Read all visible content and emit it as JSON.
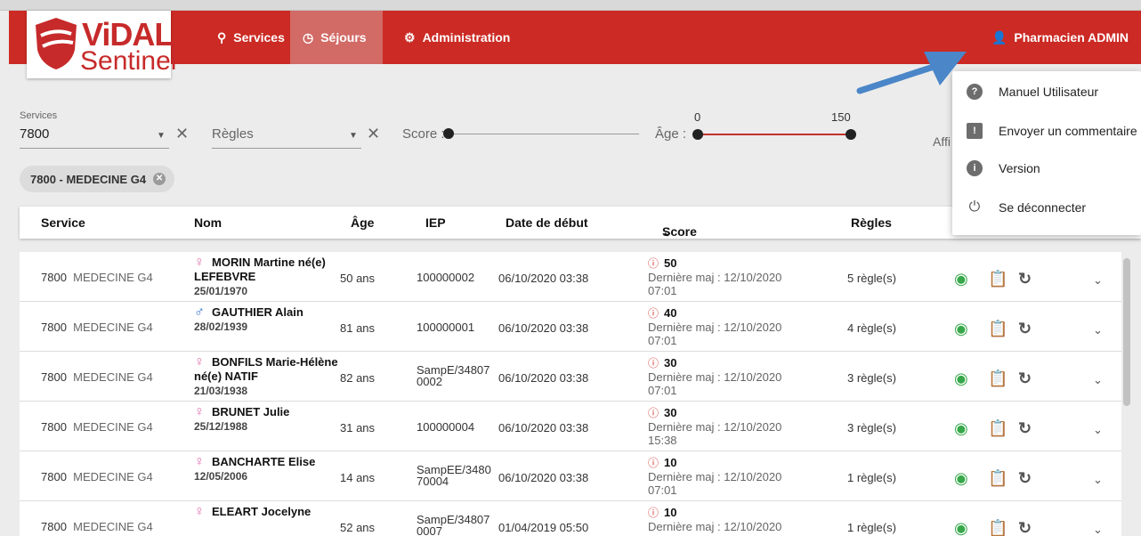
{
  "header": {
    "logo_line1": "ViDAL",
    "logo_line2": "Sentinel",
    "nav": {
      "services": "Services",
      "sejours": "Séjours",
      "administration": "Administration",
      "user": "Pharmacien ADMIN"
    }
  },
  "filters": {
    "services_label": "Services",
    "services_value": "7800",
    "regles_placeholder": "Règles",
    "score_label": "Score :",
    "age_label": "Âge :",
    "age_min": "0",
    "age_max": "150",
    "affiche_label": "Affi",
    "chip": "7800 - MEDECINE G4"
  },
  "table": {
    "headers": {
      "service": "Service",
      "nom": "Nom",
      "age": "Âge",
      "iep": "IEP",
      "date": "Date de début",
      "score": "Score",
      "regles": "Règles"
    },
    "rows": [
      {
        "svc_code": "7800",
        "svc_name": "MEDECINE G4",
        "sex": "♀",
        "sex_class": "f",
        "name": "MORIN Martine né(e) LEFEBVRE",
        "dob": "25/01/1970",
        "age": "50 ans",
        "iep": "100000002",
        "date": "06/10/2020 03:38",
        "score": "50",
        "maj": "Dernière maj : 12/10/2020",
        "maj_time": "07:01",
        "rules": "5 règle(s)"
      },
      {
        "svc_code": "7800",
        "svc_name": "MEDECINE G4",
        "sex": "♂",
        "sex_class": "m",
        "name": "GAUTHIER Alain",
        "dob": "28/02/1939",
        "age": "81 ans",
        "iep": "100000001",
        "date": "06/10/2020 03:38",
        "score": "40",
        "maj": "Dernière maj : 12/10/2020",
        "maj_time": "07:01",
        "rules": "4 règle(s)"
      },
      {
        "svc_code": "7800",
        "svc_name": "MEDECINE G4",
        "sex": "♀",
        "sex_class": "f",
        "name": "BONFILS Marie-Hélène né(e) NATIF",
        "dob": "21/03/1938",
        "age": "82 ans",
        "iep": "SampE/348070002",
        "date": "06/10/2020 03:38",
        "score": "30",
        "maj": "Dernière maj : 12/10/2020",
        "maj_time": "07:01",
        "rules": "3 règle(s)"
      },
      {
        "svc_code": "7800",
        "svc_name": "MEDECINE G4",
        "sex": "♀",
        "sex_class": "f",
        "name": "BRUNET Julie",
        "dob": "25/12/1988",
        "age": "31 ans",
        "iep": "100000004",
        "date": "06/10/2020 03:38",
        "score": "30",
        "maj": "Dernière maj : 12/10/2020",
        "maj_time": "15:38",
        "rules": "3 règle(s)"
      },
      {
        "svc_code": "7800",
        "svc_name": "MEDECINE G4",
        "sex": "♀",
        "sex_class": "f",
        "name": "BANCHARTE Elise",
        "dob": "12/05/2006",
        "age": "14 ans",
        "iep": "SampEE/348070004",
        "date": "06/10/2020 03:38",
        "score": "10",
        "maj": "Dernière maj : 12/10/2020",
        "maj_time": "07:01",
        "rules": "1 règle(s)"
      },
      {
        "svc_code": "7800",
        "svc_name": "MEDECINE G4",
        "sex": "♀",
        "sex_class": "f",
        "name": "ELEART Jocelyne",
        "dob": "",
        "age": "52 ans",
        "iep": "SampE/348070007",
        "date": "01/04/2019 05:50",
        "score": "10",
        "maj": "Dernière maj : 12/10/2020",
        "maj_time": "",
        "rules": "1 règle(s)"
      }
    ]
  },
  "menu": {
    "items": [
      {
        "label": "Manuel Utilisateur",
        "icon": "help-icon"
      },
      {
        "label": "Envoyer un commentaire",
        "icon": "feedback-icon"
      },
      {
        "label": "Version",
        "icon": "info-icon"
      },
      {
        "label": "Se déconnecter",
        "icon": "power-icon"
      }
    ]
  },
  "colors": {
    "header": "#cc2a24",
    "active_tab": "#d26a66",
    "accent_green": "#36a84a",
    "arrow": "#4a86c8"
  }
}
